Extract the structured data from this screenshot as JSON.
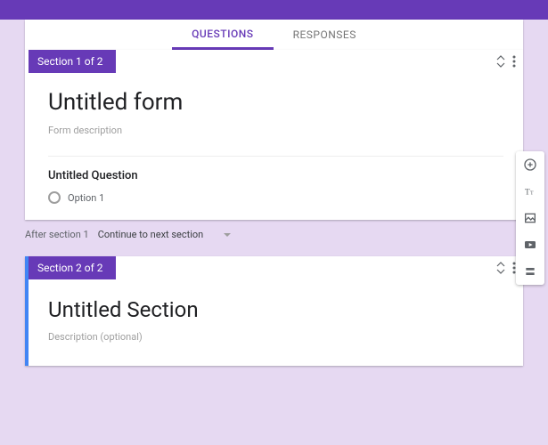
{
  "colors": {
    "primary": "#673ab7",
    "accent": "#4285f4"
  },
  "tabs": {
    "questions": "QUESTIONS",
    "responses": "RESPONSES"
  },
  "section1": {
    "badge": "Section 1 of 2",
    "title": "Untitled form",
    "description": "Form description",
    "question": "Untitled Question",
    "option1": "Option 1"
  },
  "after": {
    "label": "After section 1",
    "select": "Continue to next section"
  },
  "section2": {
    "badge": "Section 2 of 2",
    "title": "Untitled Section",
    "description": "Description (optional)"
  },
  "toolbar": {
    "add": "add-question",
    "title": "add-title",
    "image": "add-image",
    "video": "add-video",
    "section": "add-section"
  }
}
